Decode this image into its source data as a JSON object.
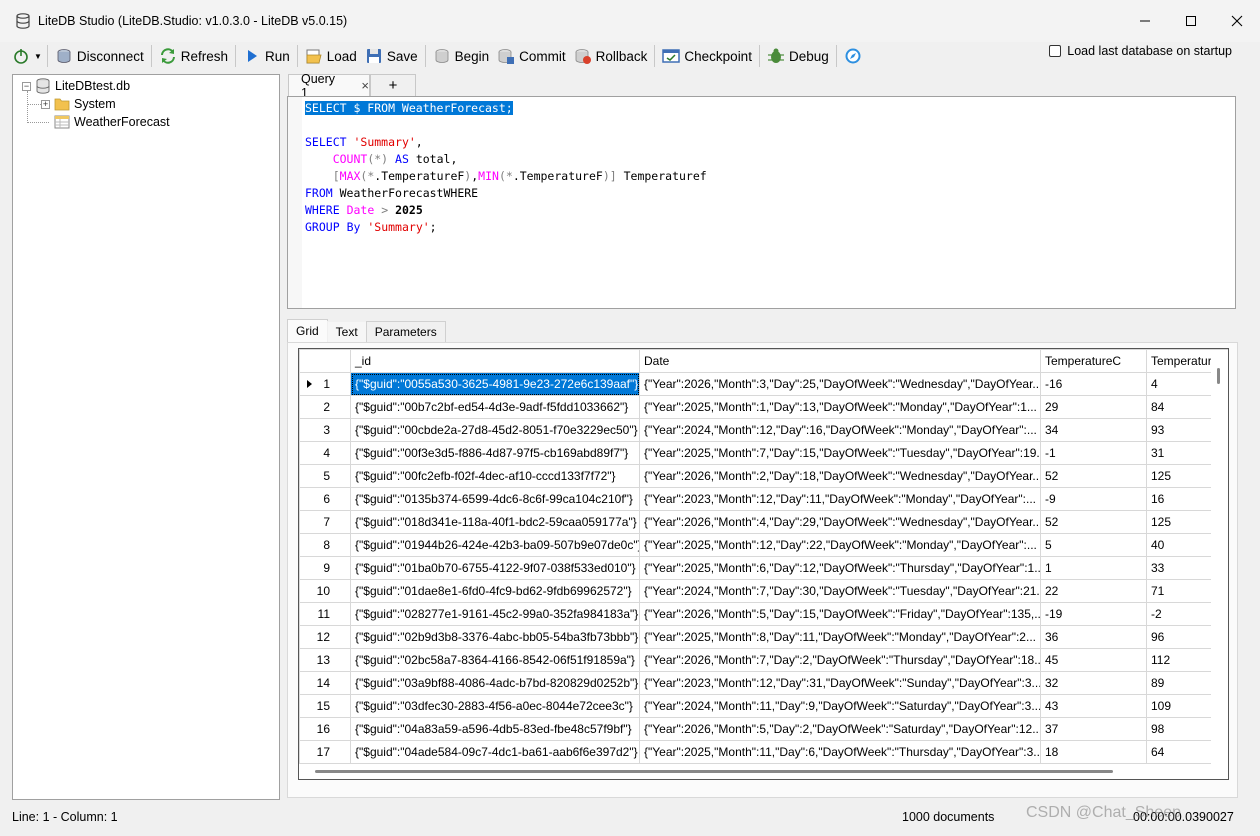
{
  "window": {
    "title": "LiteDB Studio (LiteDB.Studio: v1.0.3.0 - LiteDB v5.0.15)",
    "controls": [
      "minimize-icon",
      "maximize-icon",
      "close-icon"
    ]
  },
  "toolbar": {
    "items": [
      {
        "label": "Disconnect",
        "icon": "disconnect-icon"
      },
      {
        "label": "Refresh",
        "icon": "refresh-icon"
      },
      {
        "label": "Run",
        "icon": "run-icon"
      },
      {
        "label": "Load",
        "icon": "load-icon"
      },
      {
        "label": "Save",
        "icon": "save-icon"
      },
      {
        "label": "Begin",
        "icon": "begin-icon"
      },
      {
        "label": "Commit",
        "icon": "commit-icon"
      },
      {
        "label": "Rollback",
        "icon": "rollback-icon"
      },
      {
        "label": "Checkpoint",
        "icon": "checkpoint-icon"
      },
      {
        "label": "Debug",
        "icon": "debug-icon"
      }
    ],
    "load_last_label": "Load last database on startup",
    "load_last_checked": false
  },
  "tree": {
    "root": "LiteDBtest.db",
    "system": "System",
    "collection": "WeatherForecast"
  },
  "query_tabs": {
    "active_label": "Query 1",
    "close_glyph": "×",
    "add_glyph": "+"
  },
  "editor": {
    "lines": [
      "SELECT $ FROM WeatherForecast;",
      "",
      "SELECT 'Summary',",
      "    COUNT(*) AS total,",
      "    [MAX(*.TemperatureF),MIN(*.TemperatureF)] Temperaturef",
      "FROM WeatherForecastWHERE",
      "WHERE Date > 2025",
      "GROUP By 'Summary';"
    ]
  },
  "result_tabs": [
    "Grid",
    "Text",
    "Parameters"
  ],
  "grid": {
    "columns": [
      "",
      "_id",
      "Date",
      "TemperatureC",
      "Temperatur"
    ],
    "rows": [
      [
        "1",
        "{\"$guid\":\"0055a530-3625-4981-9e23-272e6c139aaf\"}",
        "{\"Year\":2026,\"Month\":3,\"Day\":25,\"DayOfWeek\":\"Wednesday\",\"DayOfYear...",
        "-16",
        "4"
      ],
      [
        "2",
        "{\"$guid\":\"00b7c2bf-ed54-4d3e-9adf-f5fdd1033662\"}",
        "{\"Year\":2025,\"Month\":1,\"Day\":13,\"DayOfWeek\":\"Monday\",\"DayOfYear\":1...",
        "29",
        "84"
      ],
      [
        "3",
        "{\"$guid\":\"00cbde2a-27d8-45d2-8051-f70e3229ec50\"}",
        "{\"Year\":2024,\"Month\":12,\"Day\":16,\"DayOfWeek\":\"Monday\",\"DayOfYear\":...",
        "34",
        "93"
      ],
      [
        "4",
        "{\"$guid\":\"00f3e3d5-f886-4d87-97f5-cb169abd89f7\"}",
        "{\"Year\":2025,\"Month\":7,\"Day\":15,\"DayOfWeek\":\"Tuesday\",\"DayOfYear\":19...",
        "-1",
        "31"
      ],
      [
        "5",
        "{\"$guid\":\"00fc2efb-f02f-4dec-af10-cccd133f7f72\"}",
        "{\"Year\":2026,\"Month\":2,\"Day\":18,\"DayOfWeek\":\"Wednesday\",\"DayOfYear...",
        "52",
        "125"
      ],
      [
        "6",
        "{\"$guid\":\"0135b374-6599-4dc6-8c6f-99ca104c210f\"}",
        "{\"Year\":2023,\"Month\":12,\"Day\":11,\"DayOfWeek\":\"Monday\",\"DayOfYear\":...",
        "-9",
        "16"
      ],
      [
        "7",
        "{\"$guid\":\"018d341e-118a-40f1-bdc2-59caa059177a\"}",
        "{\"Year\":2026,\"Month\":4,\"Day\":29,\"DayOfWeek\":\"Wednesday\",\"DayOfYear...",
        "52",
        "125"
      ],
      [
        "8",
        "{\"$guid\":\"01944b26-424e-42b3-ba09-507b9e07de0c\"}",
        "{\"Year\":2025,\"Month\":12,\"Day\":22,\"DayOfWeek\":\"Monday\",\"DayOfYear\":...",
        "5",
        "40"
      ],
      [
        "9",
        "{\"$guid\":\"01ba0b70-6755-4122-9f07-038f533ed010\"}",
        "{\"Year\":2025,\"Month\":6,\"Day\":12,\"DayOfWeek\":\"Thursday\",\"DayOfYear\":1...",
        "1",
        "33"
      ],
      [
        "10",
        "{\"$guid\":\"01dae8e1-6fd0-4fc9-bd62-9fdb69962572\"}",
        "{\"Year\":2024,\"Month\":7,\"Day\":30,\"DayOfWeek\":\"Tuesday\",\"DayOfYear\":21...",
        "22",
        "71"
      ],
      [
        "11",
        "{\"$guid\":\"028277e1-9161-45c2-99a0-352fa984183a\"}",
        "{\"Year\":2026,\"Month\":5,\"Day\":15,\"DayOfWeek\":\"Friday\",\"DayOfYear\":135,...",
        "-19",
        "-2"
      ],
      [
        "12",
        "{\"$guid\":\"02b9d3b8-3376-4abc-bb05-54ba3fb73bbb\"}",
        "{\"Year\":2025,\"Month\":8,\"Day\":11,\"DayOfWeek\":\"Monday\",\"DayOfYear\":2...",
        "36",
        "96"
      ],
      [
        "13",
        "{\"$guid\":\"02bc58a7-8364-4166-8542-06f51f91859a\"}",
        "{\"Year\":2026,\"Month\":7,\"Day\":2,\"DayOfWeek\":\"Thursday\",\"DayOfYear\":18...",
        "45",
        "112"
      ],
      [
        "14",
        "{\"$guid\":\"03a9bf88-4086-4adc-b7bd-820829d0252b\"}",
        "{\"Year\":2023,\"Month\":12,\"Day\":31,\"DayOfWeek\":\"Sunday\",\"DayOfYear\":3...",
        "32",
        "89"
      ],
      [
        "15",
        "{\"$guid\":\"03dfec30-2883-4f56-a0ec-8044e72cee3c\"}",
        "{\"Year\":2024,\"Month\":11,\"Day\":9,\"DayOfWeek\":\"Saturday\",\"DayOfYear\":3...",
        "43",
        "109"
      ],
      [
        "16",
        "{\"$guid\":\"04a83a59-a596-4db5-83ed-fbe48c57f9bf\"}",
        "{\"Year\":2026,\"Month\":5,\"Day\":2,\"DayOfWeek\":\"Saturday\",\"DayOfYear\":12...",
        "37",
        "98"
      ],
      [
        "17",
        "{\"$guid\":\"04ade584-09c7-4dc1-ba61-aab6f6e397d2\"}",
        "{\"Year\":2025,\"Month\":11,\"Day\":6,\"DayOfWeek\":\"Thursday\",\"DayOfYear\":3...",
        "18",
        "64"
      ]
    ]
  },
  "status": {
    "position": "Line: 1 - Column: 1",
    "documents": "1000 documents",
    "elapsed": "00:00:00.0390027"
  },
  "watermark": "CSDN @Chat_Sheep"
}
